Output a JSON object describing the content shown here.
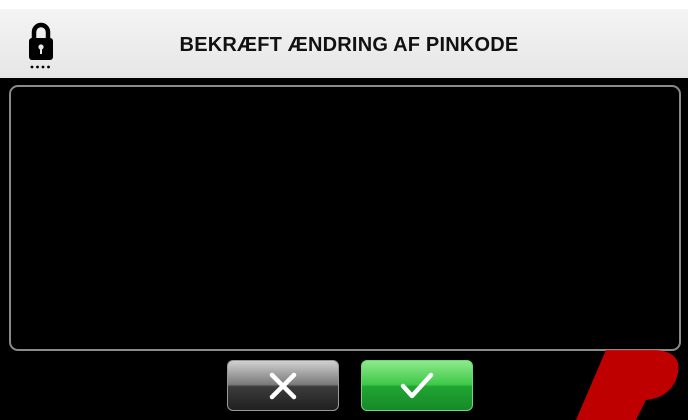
{
  "header": {
    "title": "BEKRÆFT ÆNDRING AF PINKODE",
    "icon": "lock-icon"
  },
  "content": {
    "text": ""
  },
  "buttons": {
    "cancel": {
      "icon": "close-icon",
      "color": "#3a3a3a"
    },
    "confirm": {
      "icon": "checkmark-icon",
      "color": "#2fb83c"
    }
  },
  "colors": {
    "background": "#000000",
    "header_bg": "#eeeeee",
    "panel_border": "#8a8a8a",
    "watermark": "#d40000"
  }
}
